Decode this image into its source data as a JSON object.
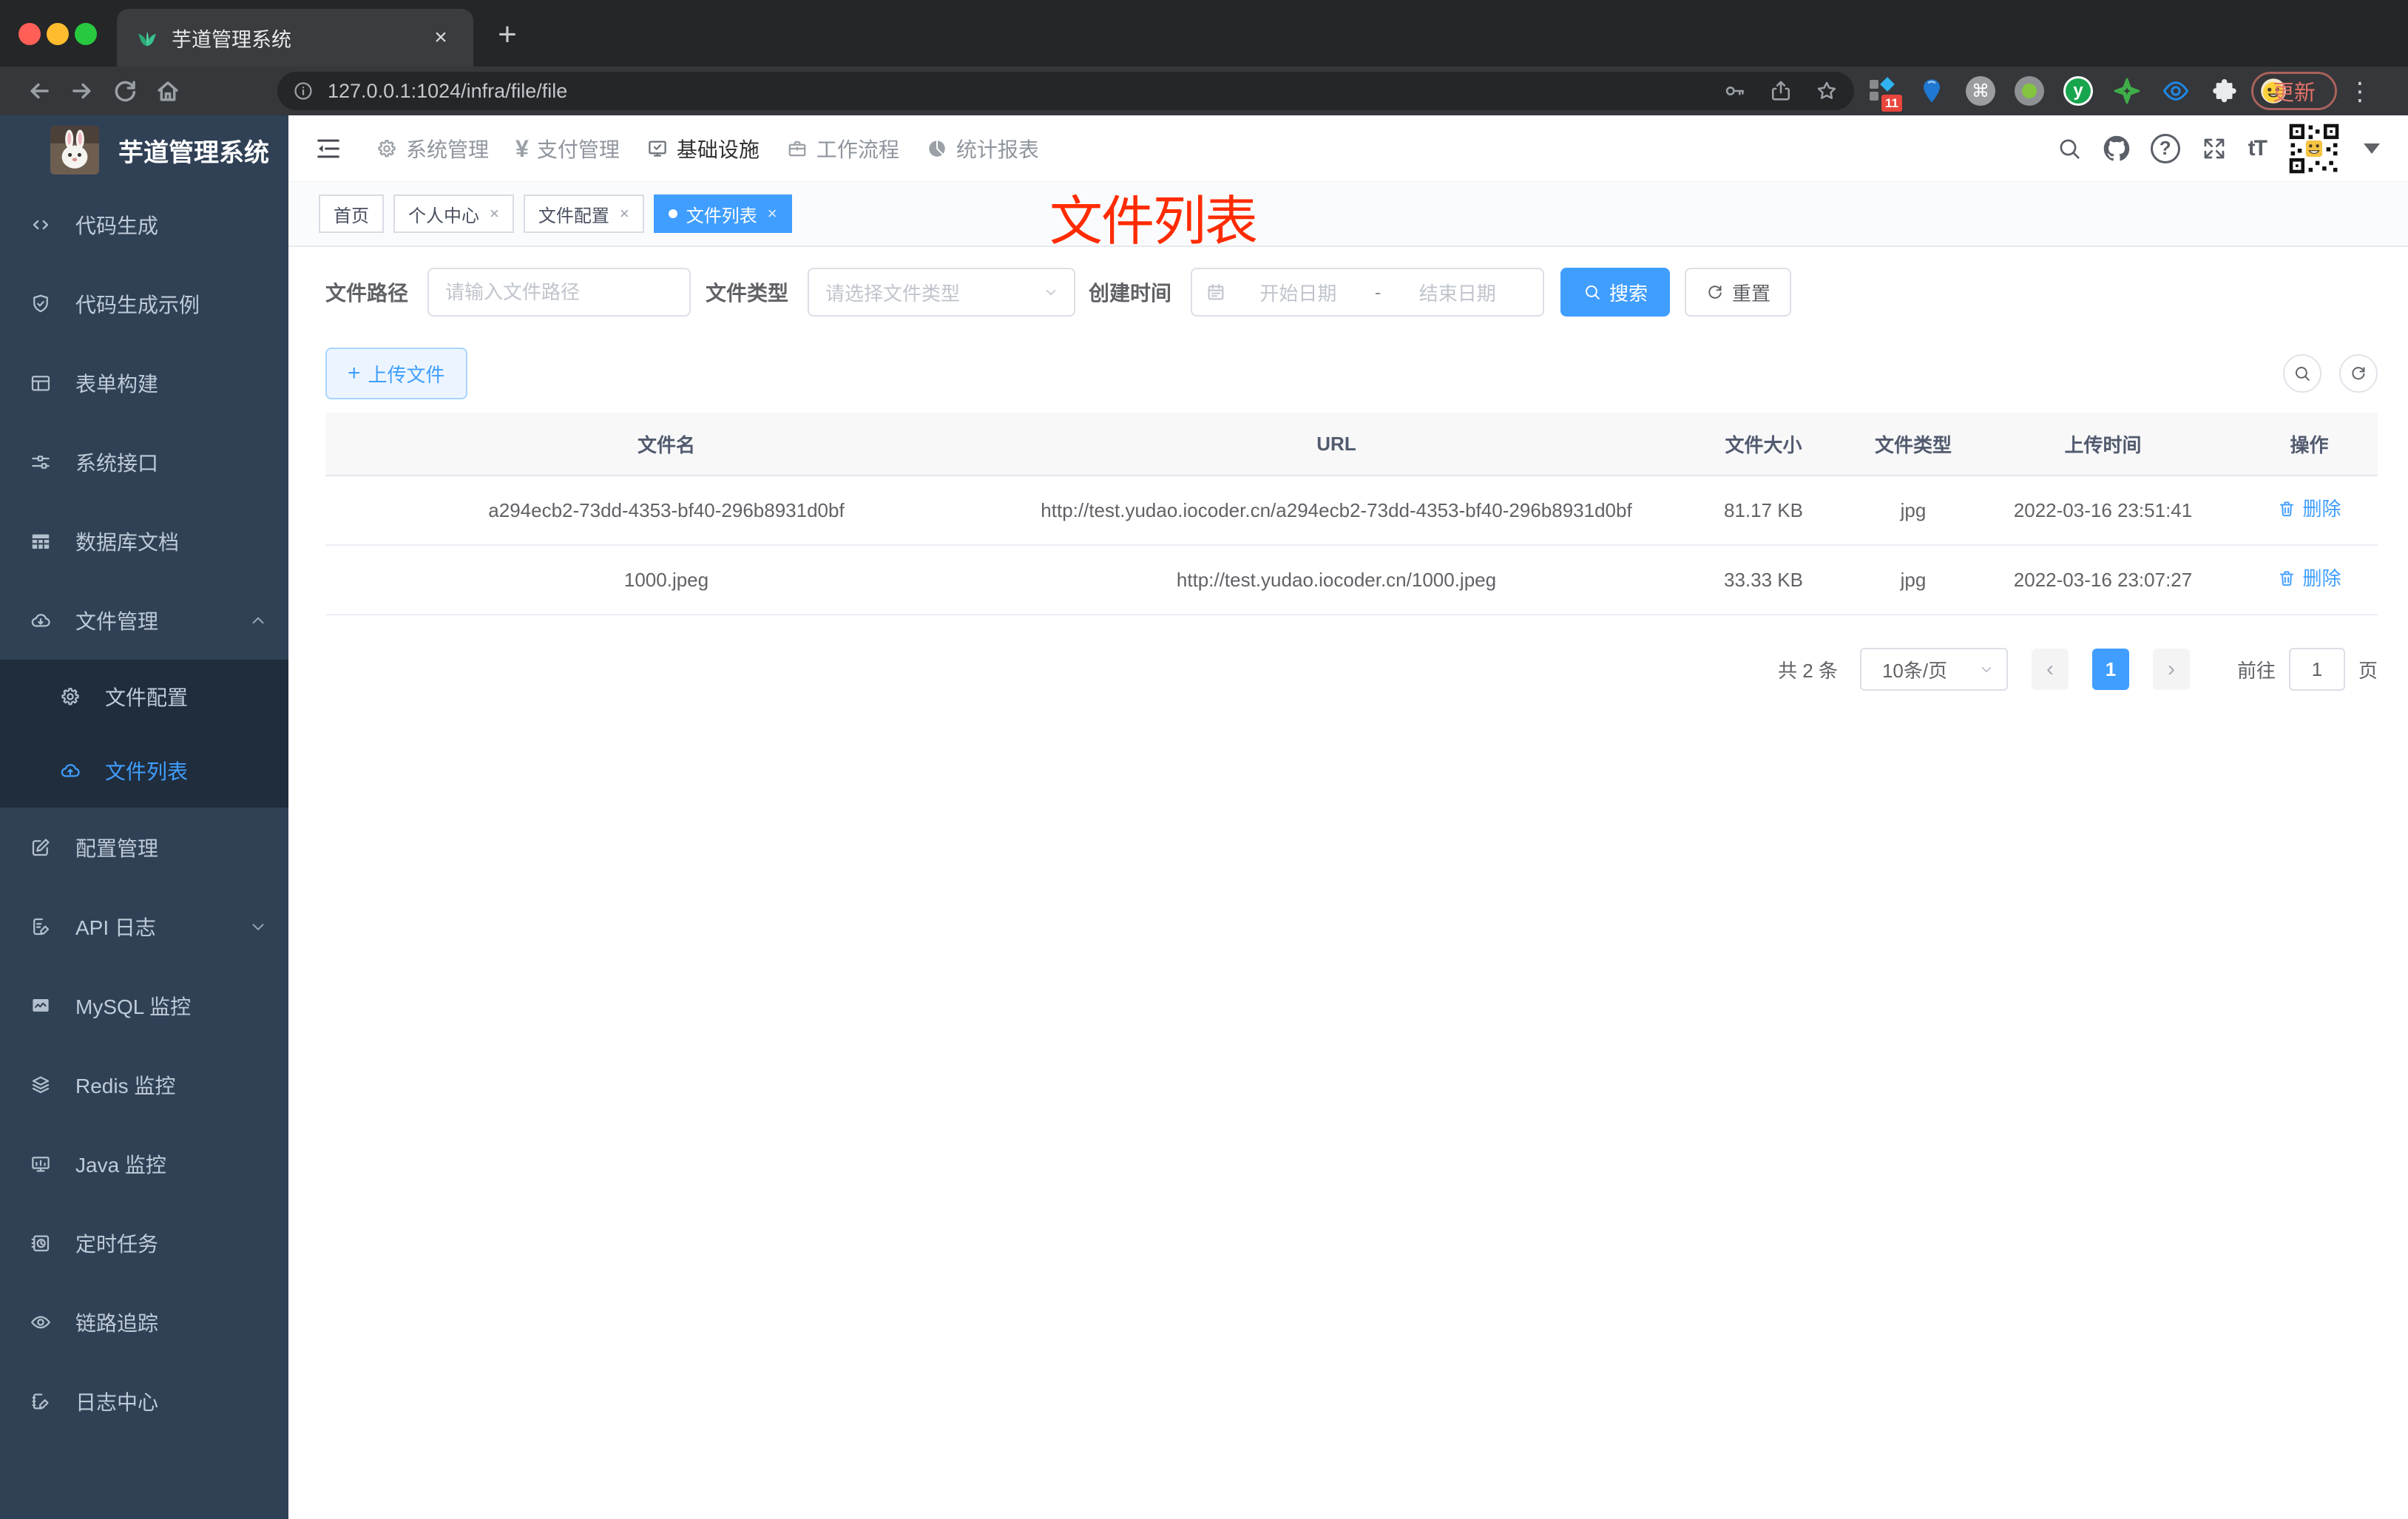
{
  "browser": {
    "tab_title": "芋道管理系统",
    "url": "127.0.0.1:1024/infra/file/file",
    "update_label": "更新",
    "extension_badge": "11"
  },
  "icons": {
    "close": "×",
    "plus": "+",
    "menu_dots": "⋮",
    "command": "⌘",
    "y_logo": "y",
    "help": "?",
    "font_size": "tT",
    "yen": "¥",
    "pager_prev": "‹",
    "pager_next": "›"
  },
  "sidebar": {
    "title": "芋道管理系统",
    "items_top": [
      {
        "label": "代码生成"
      },
      {
        "label": "代码生成示例"
      },
      {
        "label": "表单构建"
      },
      {
        "label": "系统接口"
      },
      {
        "label": "数据库文档"
      },
      {
        "label": "文件管理"
      }
    ],
    "submenu": [
      {
        "label": "文件配置"
      },
      {
        "label": "文件列表"
      }
    ],
    "items_bottom": [
      {
        "label": "配置管理"
      },
      {
        "label": "API 日志"
      },
      {
        "label": "MySQL 监控"
      },
      {
        "label": "Redis 监控"
      },
      {
        "label": "Java 监控"
      },
      {
        "label": "定时任务"
      },
      {
        "label": "链路追踪"
      },
      {
        "label": "日志中心"
      }
    ]
  },
  "topnav": {
    "items": [
      {
        "label": "系统管理"
      },
      {
        "label": "支付管理"
      },
      {
        "label": "基础设施"
      },
      {
        "label": "工作流程"
      },
      {
        "label": "统计报表"
      }
    ]
  },
  "tabs": [
    {
      "label": "首页"
    },
    {
      "label": "个人中心"
    },
    {
      "label": "文件配置"
    },
    {
      "label": "文件列表"
    }
  ],
  "annotation": "文件列表",
  "filters": {
    "path_label": "文件路径",
    "path_placeholder": "请输入文件路径",
    "type_label": "文件类型",
    "type_placeholder": "请选择文件类型",
    "date_label": "创建时间",
    "date_start": "开始日期",
    "date_separator": "-",
    "date_end": "结束日期",
    "search_label": "搜索",
    "reset_label": "重置"
  },
  "toolbar": {
    "upload_label": "上传文件"
  },
  "table": {
    "columns": [
      "文件名",
      "URL",
      "文件大小",
      "文件类型",
      "上传时间",
      "操作"
    ],
    "rows": [
      {
        "name": "a294ecb2-73dd-4353-bf40-296b8931d0bf",
        "url": "http://test.yudao.iocoder.cn/a294ecb2-73dd-4353-bf40-296b8931d0bf",
        "size": "81.17 KB",
        "type": "jpg",
        "time": "2022-03-16 23:51:41",
        "action": "删除"
      },
      {
        "name": "1000.jpeg",
        "url": "http://test.yudao.iocoder.cn/1000.jpeg",
        "size": "33.33 KB",
        "type": "jpg",
        "time": "2022-03-16 23:07:27",
        "action": "删除"
      }
    ]
  },
  "pagination": {
    "total": "共 2 条",
    "page_size": "10条/页",
    "current_page": "1",
    "goto_label": "前往",
    "goto_value": "1",
    "page_unit": "页"
  },
  "colors": {
    "accent": "#409eff",
    "annotation_red": "#ff2b00",
    "sidebar_bg": "#304156",
    "submenu_bg": "#1f2d3d"
  }
}
